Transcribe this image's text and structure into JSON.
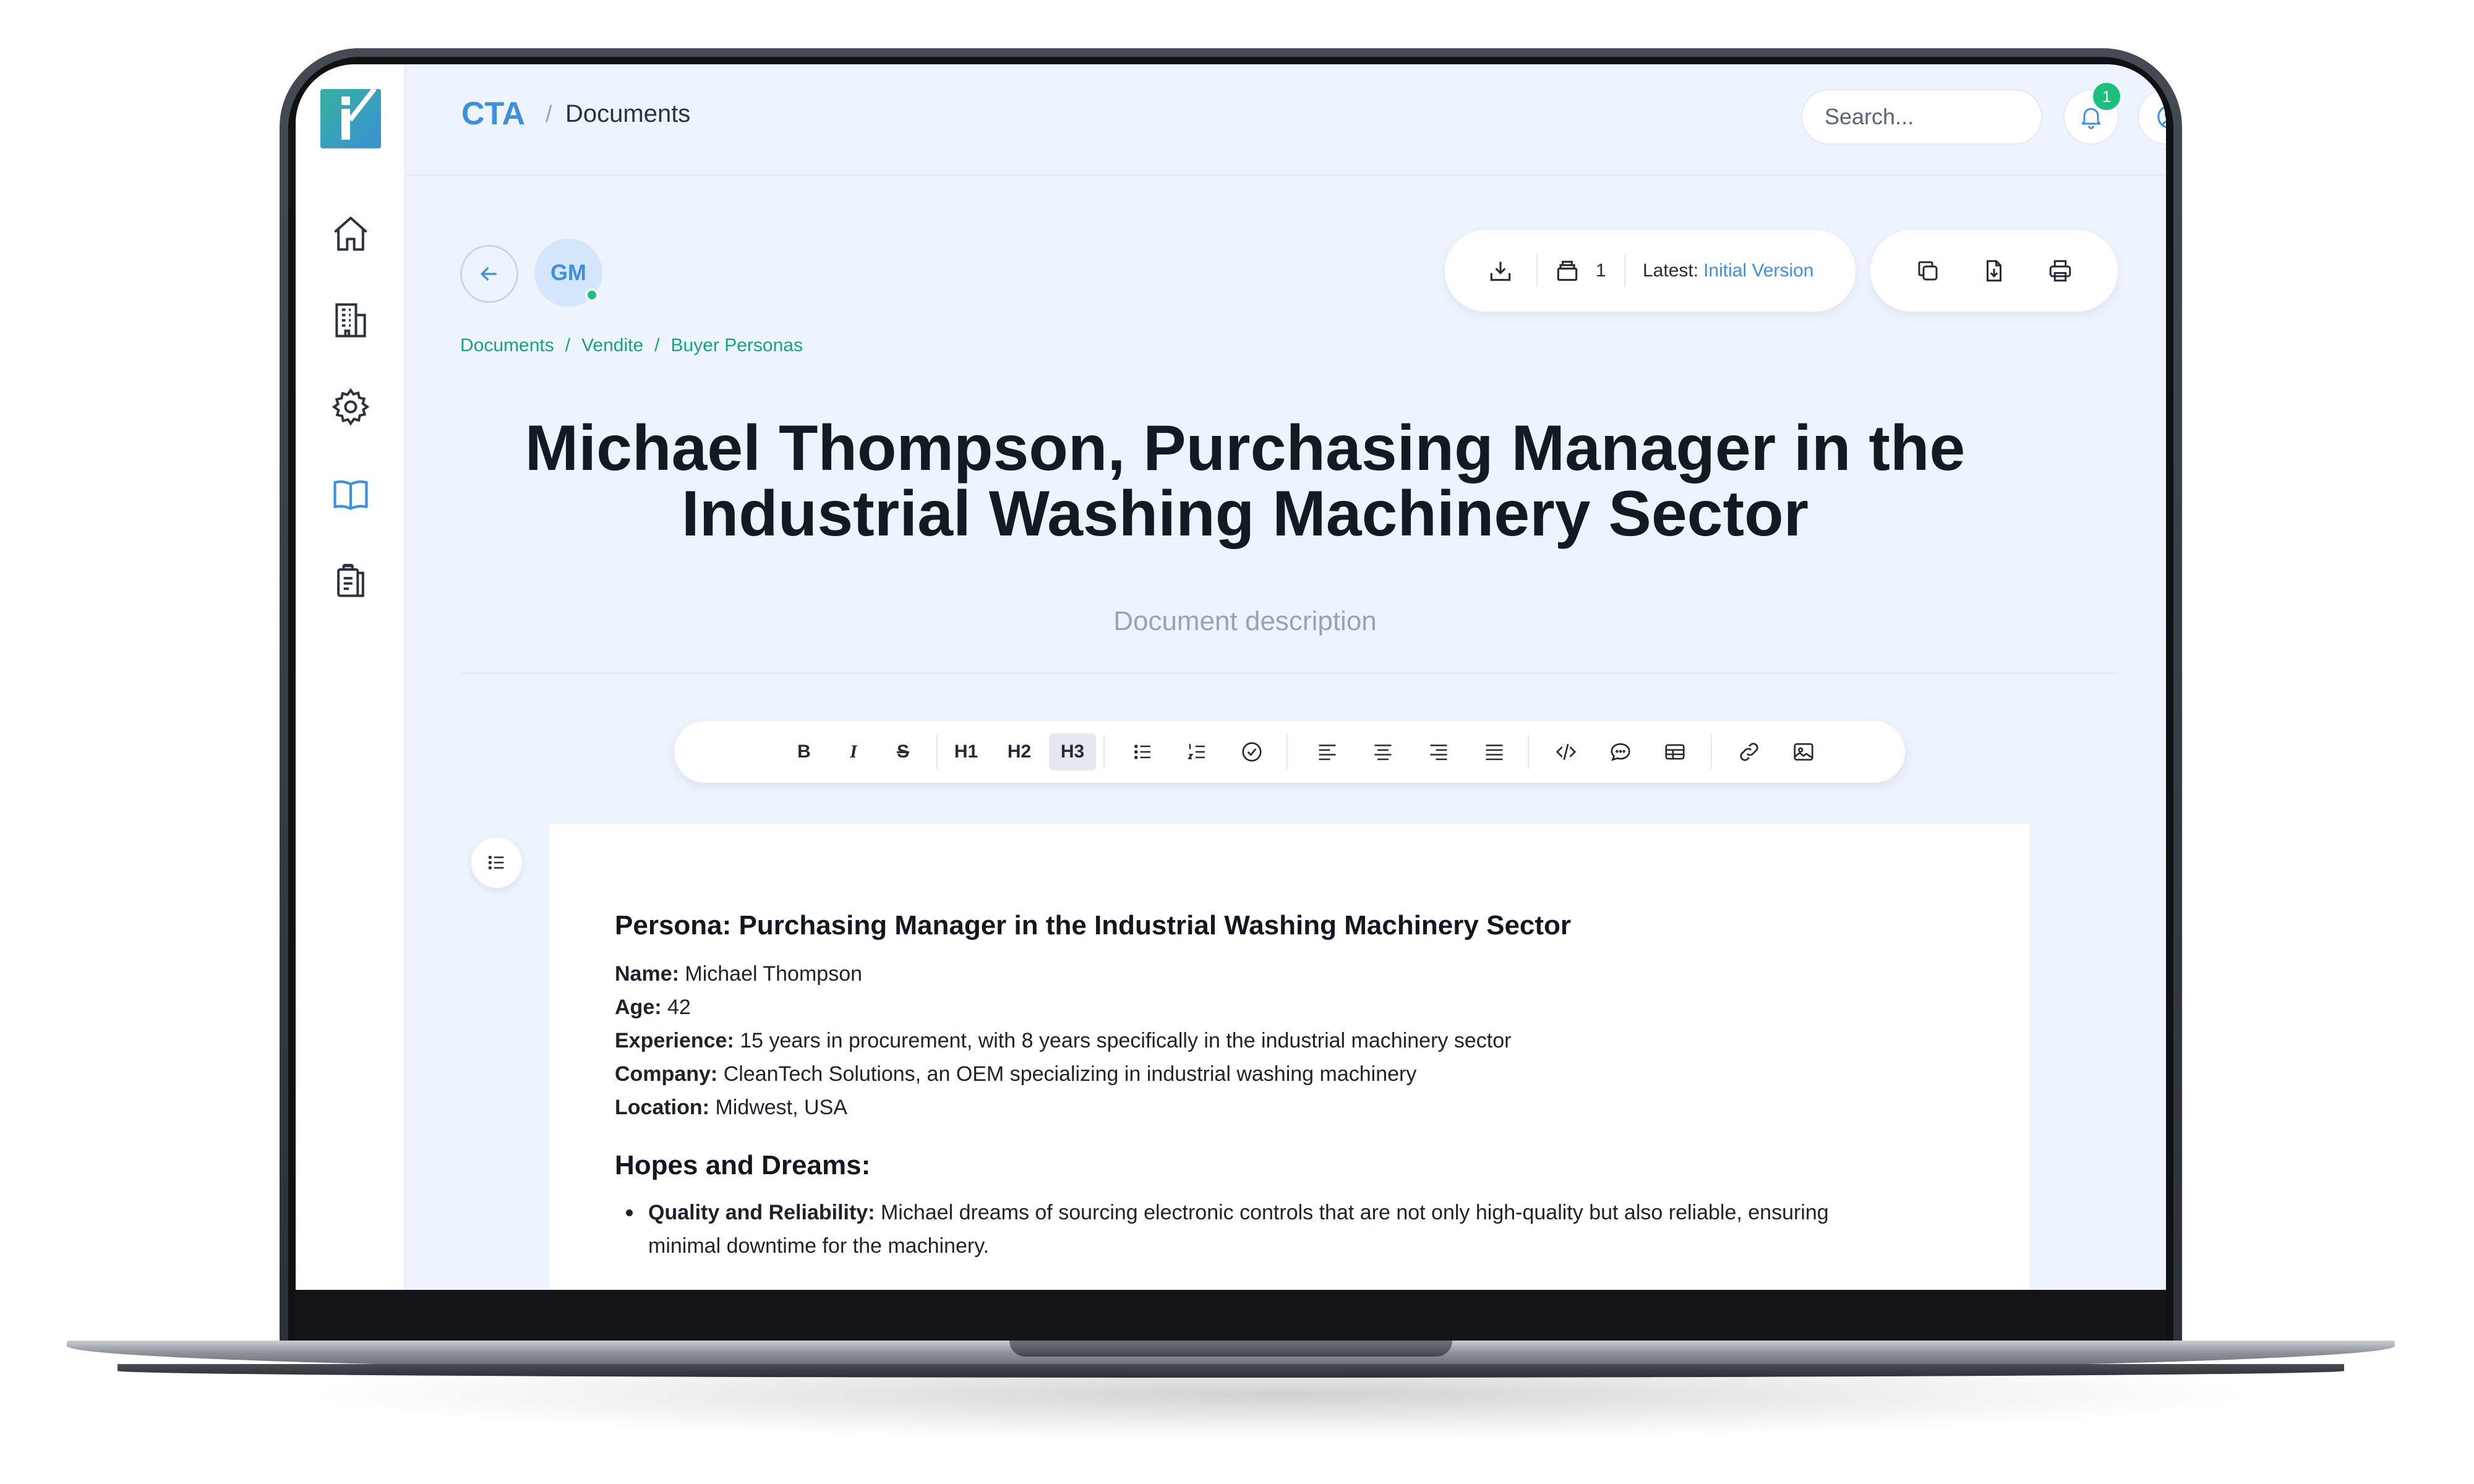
{
  "topbar": {
    "brand": "CTA",
    "breadcrumb_separator": "/",
    "breadcrumb_current": "Documents",
    "search_placeholder": "Search...",
    "notification_count": "1"
  },
  "sidebar": {
    "items": [
      {
        "icon": "home-icon"
      },
      {
        "icon": "building-icon"
      },
      {
        "icon": "gear-icon"
      },
      {
        "icon": "book-icon"
      },
      {
        "icon": "clipboard-icon"
      }
    ],
    "active_item": "book-icon"
  },
  "document_header": {
    "avatar_initials": "GM",
    "versions_count": "1",
    "latest_label": "Latest:",
    "latest_version": "Initial Version",
    "breadcrumbs": [
      "Documents",
      "Vendite",
      "Buyer Personas"
    ],
    "breadcrumb_separator": "/"
  },
  "document": {
    "title": "Michael Thompson, Purchasing Manager in the Industrial Washing Machinery Sector",
    "description_placeholder": "Document description"
  },
  "toolbar": {
    "buttons": [
      "B",
      "I",
      "S",
      "H1",
      "H2",
      "H3"
    ],
    "active": "H3"
  },
  "content": {
    "heading": "Persona: Purchasing Manager in the Industrial Washing Machinery Sector",
    "fields": [
      {
        "label": "Name:",
        "value": "Michael Thompson"
      },
      {
        "label": "Age:",
        "value": "42"
      },
      {
        "label": "Experience:",
        "value": "15 years in procurement, with 8 years specifically in the industrial machinery sector"
      },
      {
        "label": "Company:",
        "value": "CleanTech Solutions, an OEM specializing in industrial washing machinery"
      },
      {
        "label": "Location:",
        "value": "Midwest, USA"
      }
    ],
    "section_heading": "Hopes and Dreams:",
    "bullets": [
      {
        "label": "Quality and Reliability:",
        "value": "Michael dreams of sourcing electronic controls that are not only high-quality but also reliable, ensuring minimal downtime for the machinery."
      }
    ]
  },
  "colors": {
    "accent": "#3d8fe0",
    "breadcrumb_green": "#17a673",
    "badge_green": "#1cbf7c",
    "background": "#eef4fd"
  }
}
